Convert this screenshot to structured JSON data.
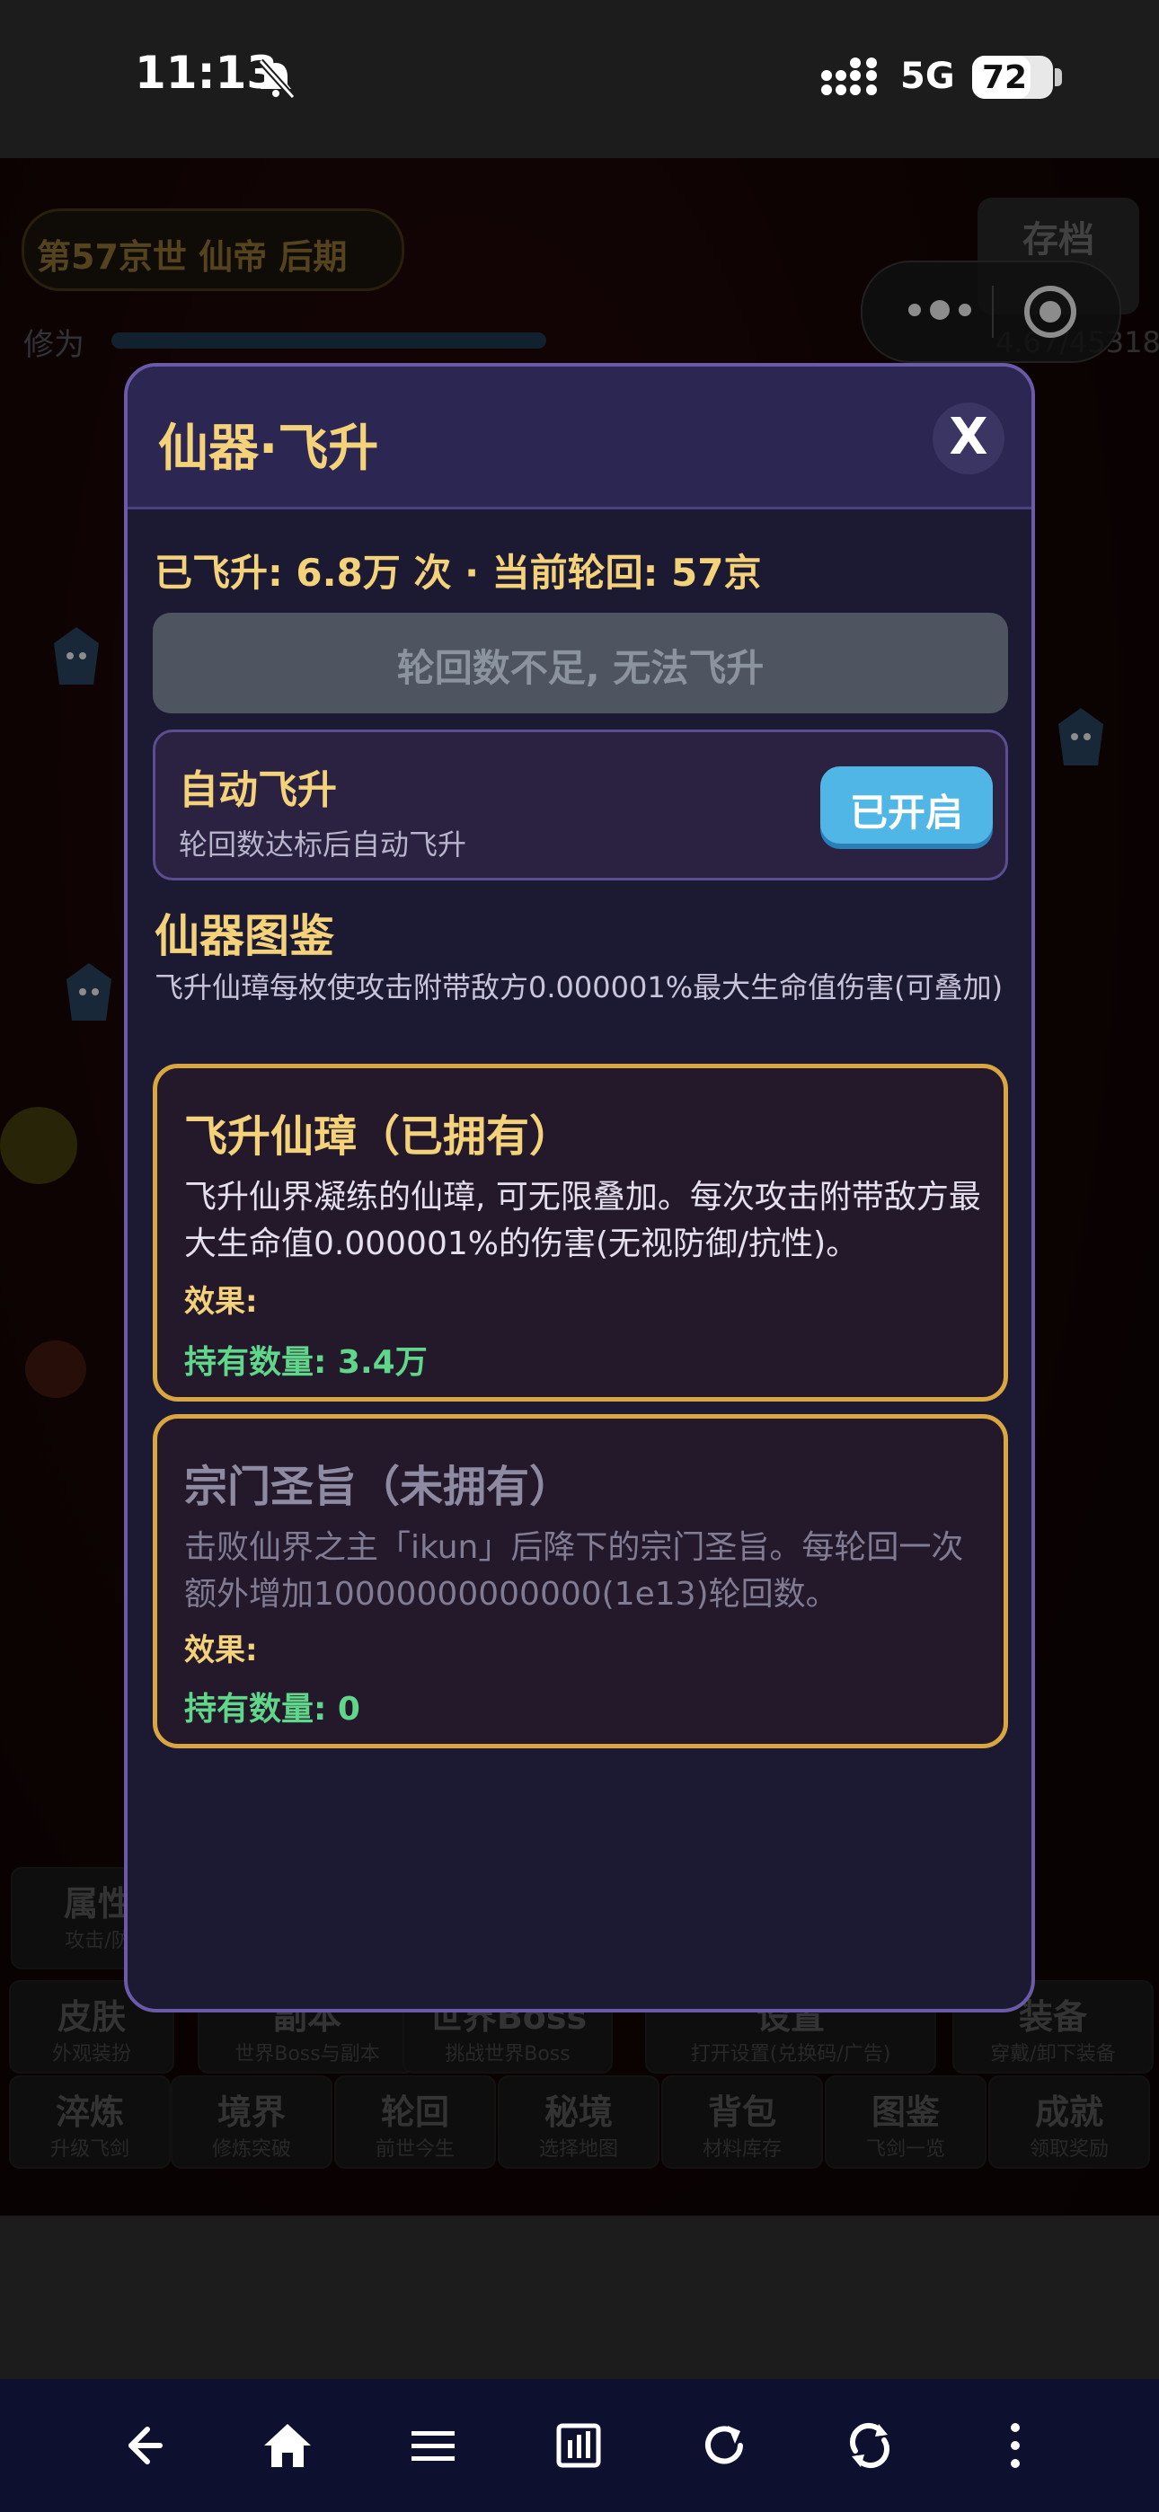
{
  "status_bar": {
    "time": "11:13",
    "network": "5G",
    "battery": "72",
    "battery_level": 0.72
  },
  "background": {
    "realm": "第57京世 仙帝 后期",
    "cultivation_label": "修为",
    "save_label": "存档",
    "save_value": "4.67/45318",
    "grid_row1": [
      {
        "title": "属性",
        "sub": "攻击/防"
      }
    ],
    "grid_row2": [
      {
        "title": "皮肤",
        "sub": "外观装扮"
      },
      {
        "title": "副本",
        "sub": "世界Boss与副本"
      },
      {
        "title": "世界Boss",
        "sub": "挑战世界Boss"
      },
      {
        "title": "设置",
        "sub": "打开设置(兑换码/广告)"
      },
      {
        "title": "装备",
        "sub": "穿戴/卸下装备"
      }
    ],
    "grid_row3": [
      {
        "title": "淬炼",
        "sub": "升级飞剑"
      },
      {
        "title": "境界",
        "sub": "修炼突破"
      },
      {
        "title": "轮回",
        "sub": "前世今生"
      },
      {
        "title": "秘境",
        "sub": "选择地图"
      },
      {
        "title": "背包",
        "sub": "材料库存"
      },
      {
        "title": "图鉴",
        "sub": "飞剑一览"
      },
      {
        "title": "成就",
        "sub": "领取奖励"
      }
    ]
  },
  "modal": {
    "title": "仙器·飞升",
    "close_label": "X",
    "info_line": "已飞升: 6.8万 次 · 当前轮回: 57京",
    "ascend_button": "轮回数不足, 无法飞升",
    "auto": {
      "title": "自动飞升",
      "desc": "轮回数达标后自动飞升",
      "toggle_label": "已开启"
    },
    "catalog_title": "仙器图鉴",
    "catalog_desc": "飞升仙璋每枚使攻击附带敌方0.000001%最大生命值伤害(可叠加)",
    "items": [
      {
        "name": "飞升仙璋（已拥有）",
        "desc": "飞升仙界凝练的仙璋, 可无限叠加。每次攻击附带敌方最大生命值0.000001%的伤害(无视防御/抗性)。",
        "effect_label": "效果:",
        "count": "持有数量: 3.4万"
      },
      {
        "name": "宗门圣旨（未拥有）",
        "desc": "击败仙界之主「ikun」后降下的宗门圣旨。每轮回一次额外增加10000000000000(1e13)轮回数。",
        "effect_label": "效果:",
        "count": "持有数量: 0"
      }
    ]
  },
  "colors": {
    "accent_gold": "#f4d27a",
    "count_green": "#5fd68a",
    "toggle_blue": "#4fb6e6",
    "modal_bg": "#1c1a33"
  },
  "nav_icons": [
    "back-icon",
    "home-icon",
    "menu-icon",
    "tabs-icon",
    "refresh-icon",
    "sync-icon",
    "more-icon"
  ]
}
